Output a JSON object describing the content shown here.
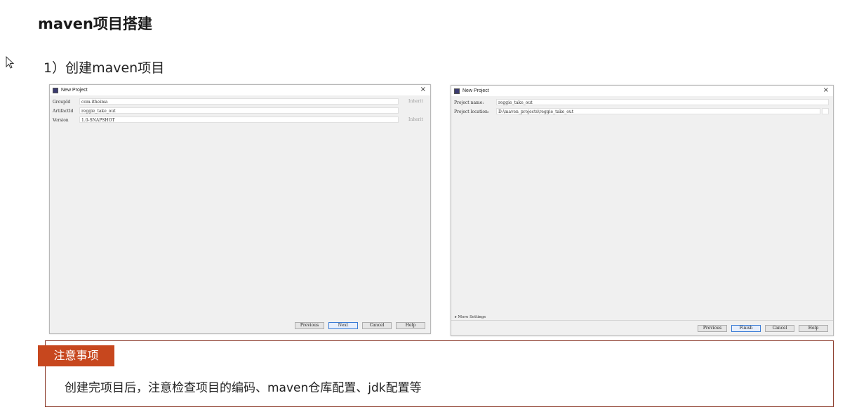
{
  "slide": {
    "title": "maven项目搭建",
    "step": "1）创建maven项目"
  },
  "dialog_left": {
    "title": "New Project",
    "close": "×",
    "fields": [
      {
        "label": "GroupId",
        "value": "com.itheima",
        "inherit": "Inherit"
      },
      {
        "label": "ArtifactId",
        "value": "reggie_take_out",
        "inherit": ""
      },
      {
        "label": "Version",
        "value": "1.0-SNAPSHOT",
        "inherit": "Inherit"
      }
    ],
    "buttons": {
      "previous": "Previous",
      "next": "Next",
      "cancel": "Cancel",
      "help": "Help"
    }
  },
  "dialog_right": {
    "title": "New Project",
    "close": "×",
    "fields": [
      {
        "label": "Project name:",
        "value": "reggie_take_out"
      },
      {
        "label": "Project location:",
        "value": "D:\\maven_projects\\reggie_take_out"
      }
    ],
    "more_settings": "▸ More Settings",
    "buttons": {
      "previous": "Previous",
      "finish": "Finish",
      "cancel": "Cancel",
      "help": "Help"
    }
  },
  "notice": {
    "tag": "注意事项",
    "text": "创建完项目后，注意检查项目的编码、maven仓库配置、jdk配置等"
  },
  "colors": {
    "accent": "#c7471e",
    "border": "#8b3a2a",
    "primary_button": "#3a7bd5"
  }
}
